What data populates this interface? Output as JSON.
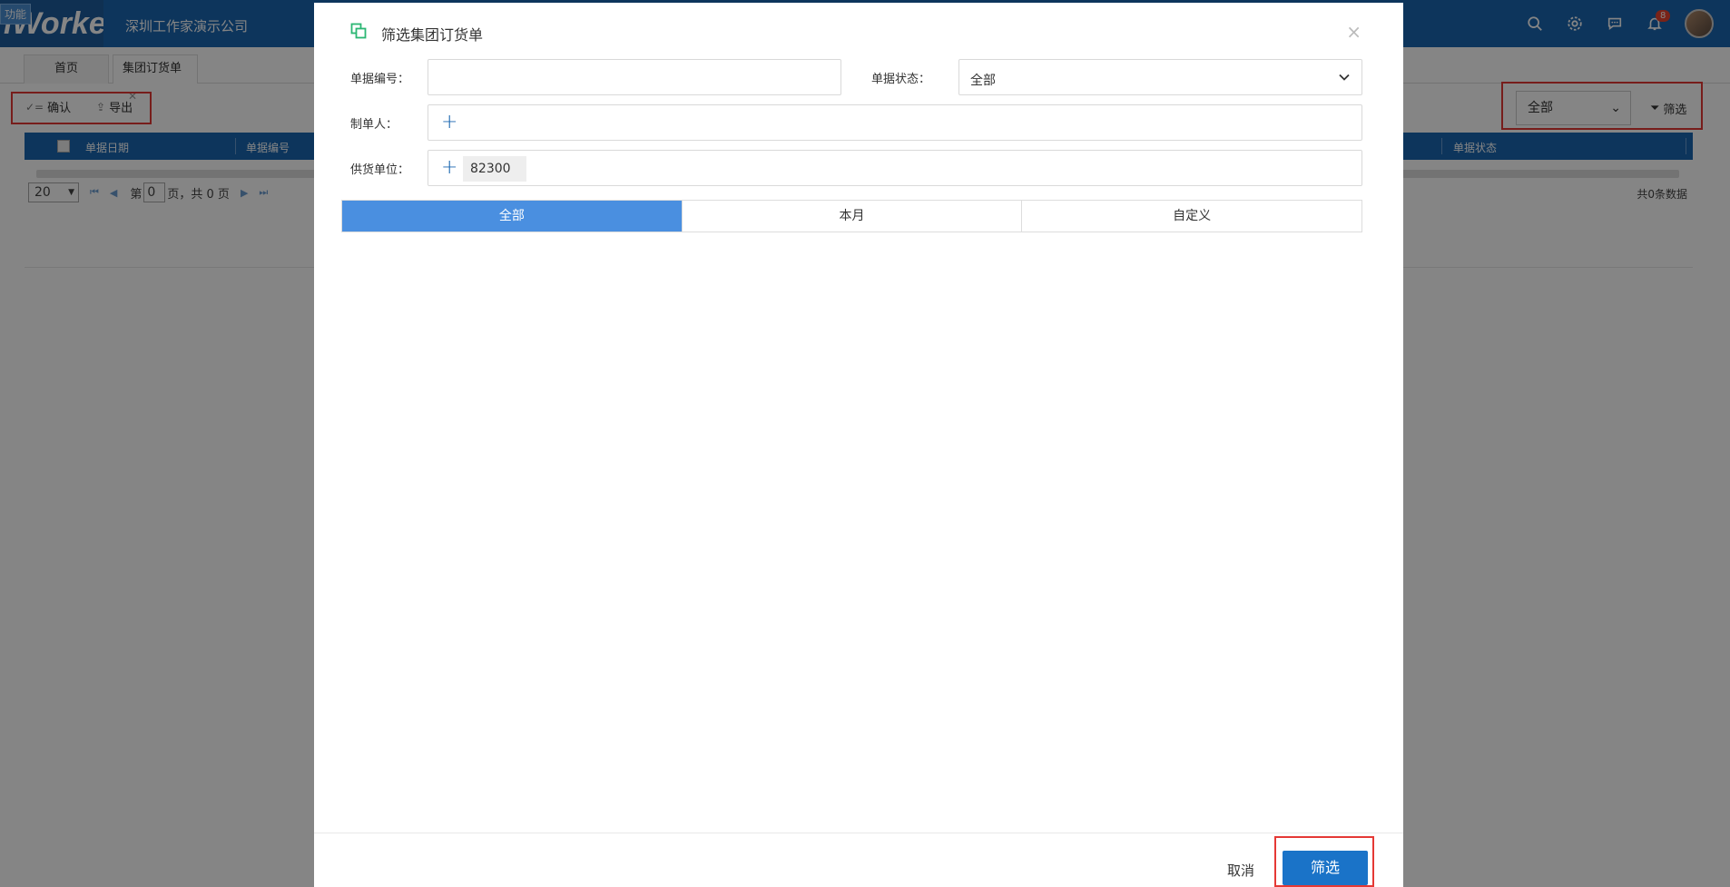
{
  "app": {
    "logo_text": "iWorker",
    "logo_badge": "功能",
    "company": "深圳工作家演示公司",
    "notification_count": "8"
  },
  "tabs": [
    {
      "label": "首页"
    },
    {
      "label": "集团订货单"
    }
  ],
  "toolbar": {
    "confirm_label": "确认",
    "export_label": "导出",
    "status_value": "全部",
    "filter_label": "筛选"
  },
  "grid": {
    "columns": [
      "单据日期",
      "单据编号",
      "单据状态"
    ],
    "page_size": "20",
    "page_prefix": "第",
    "page_value": "0",
    "page_suffix": "页，共 0 页",
    "total": "共0条数据"
  },
  "modal": {
    "title": "筛选集团订货单",
    "doc_no_label": "单据编号：",
    "doc_no_value": "",
    "doc_status_label": "单据状态：",
    "doc_status_value": "全部",
    "creator_label": "制单人：",
    "supplier_label": "供货单位：",
    "supplier_chip": "82300",
    "period_options": [
      "全部",
      "本月",
      "自定义"
    ],
    "period_selected": "全部",
    "cancel_label": "取消",
    "submit_label": "筛选"
  },
  "colors": {
    "primary": "#1a66b0",
    "active_segment": "#4a8fe0",
    "submit_button": "#1a73c8",
    "highlight_frame": "#e53935"
  }
}
